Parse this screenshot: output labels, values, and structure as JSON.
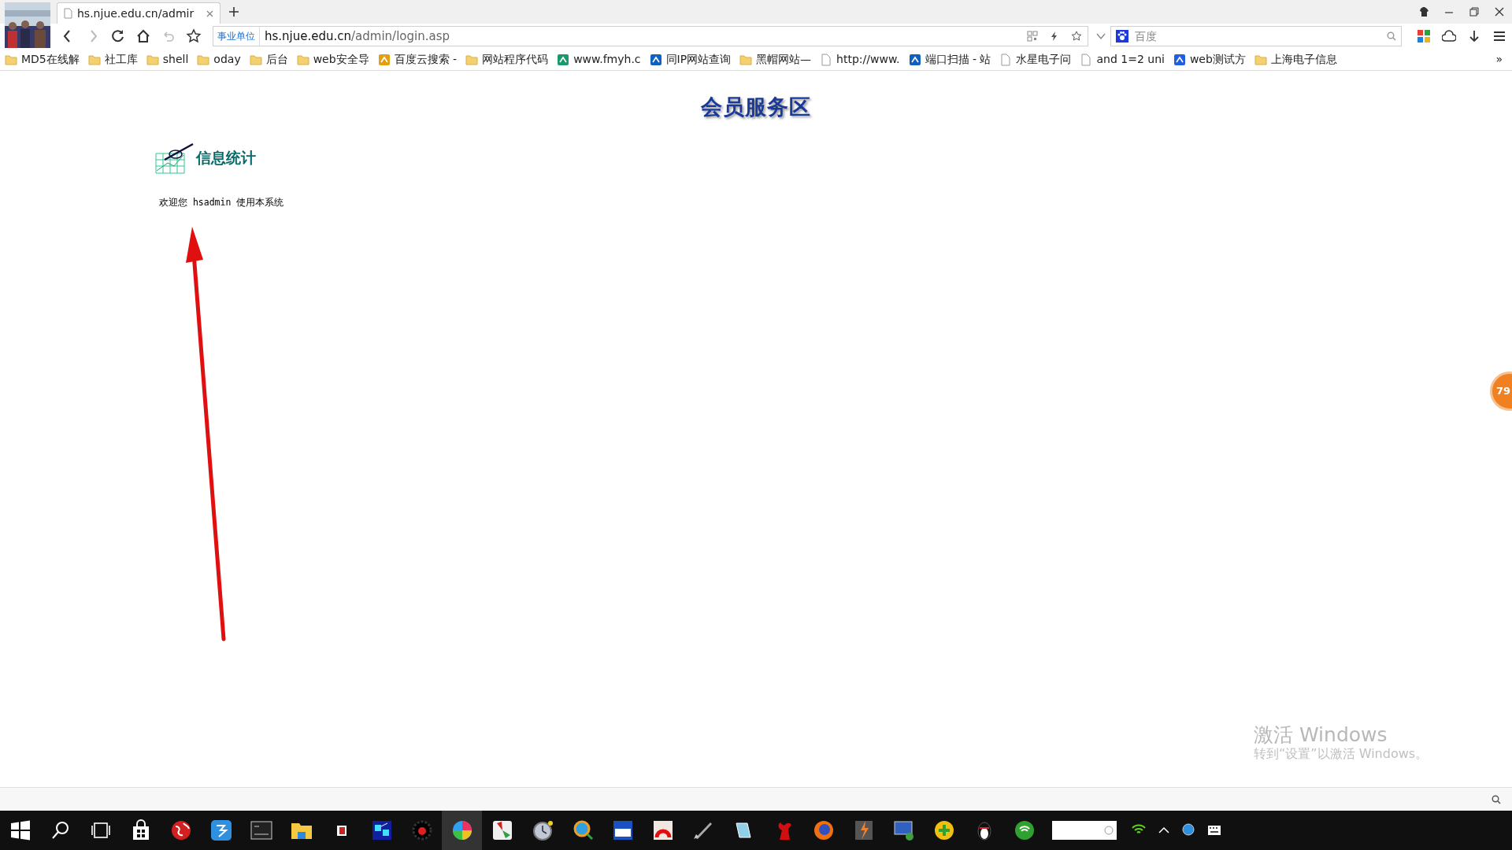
{
  "browser": {
    "tab": {
      "title": "hs.njue.edu.cn/admir",
      "selected": true
    },
    "address": {
      "badge": "事业单位",
      "host": "hs.njue.edu.cn",
      "path": "/admin/login.asp"
    },
    "search": {
      "placeholder": "百度"
    },
    "bookmarks": [
      {
        "label": "MD5在线解",
        "kind": "folder"
      },
      {
        "label": "社工库",
        "kind": "folder"
      },
      {
        "label": "shell",
        "kind": "folder"
      },
      {
        "label": "oday",
        "kind": "folder"
      },
      {
        "label": "后台",
        "kind": "folder"
      },
      {
        "label": "web安全导",
        "kind": "folder"
      },
      {
        "label": "百度云搜索 -",
        "kind": "site",
        "color": "#e0a010"
      },
      {
        "label": "网站程序代码",
        "kind": "folder"
      },
      {
        "label": "www.fmyh.c",
        "kind": "site",
        "color": "#1a9a6a"
      },
      {
        "label": "同IP网站查询",
        "kind": "site",
        "color": "#1060c0"
      },
      {
        "label": "黑帽网站—",
        "kind": "folder"
      },
      {
        "label": "http://www.",
        "kind": "page"
      },
      {
        "label": "端口扫描 - 站",
        "kind": "site",
        "color": "#1060c0"
      },
      {
        "label": "水星电子问",
        "kind": "page"
      },
      {
        "label": "and 1=2 uni",
        "kind": "page"
      },
      {
        "label": "web测试方",
        "kind": "site",
        "color": "#2060e0"
      },
      {
        "label": "上海电子信息",
        "kind": "folder"
      }
    ],
    "more": "»"
  },
  "page": {
    "banner": "会员服务区",
    "section_title": "信息统计",
    "welcome": "欢迎您 hsadmin 使用本系统",
    "side_badge": "79"
  },
  "desktop": {
    "activation_title": "激活 Windows",
    "activation_hint": "转到“设置”以激活 Windows。"
  }
}
